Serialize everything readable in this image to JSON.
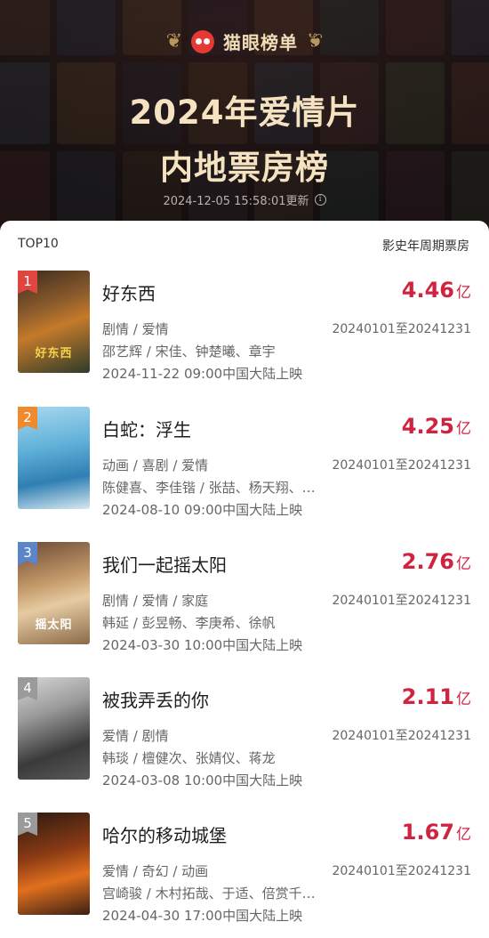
{
  "header": {
    "brand": "猫眼榜单",
    "title_line1": "2024年爱情片",
    "title_line2": "内地票房榜",
    "updated": "2024-12-05 15:58:01更新"
  },
  "list": {
    "top_label": "TOP10",
    "right_label": "影史年周期票房",
    "items": [
      {
        "rank": "1",
        "title": "好东西",
        "genre": "剧情 / 爱情",
        "cast": "邵艺辉 / 宋佳、钟楚曦、章宇",
        "release": "2024-11-22 09:00中国大陆上映",
        "period": "20240101至20241231",
        "box_value": "4.46",
        "box_unit": "亿",
        "poster_text": "好东西",
        "rank_color": "#e0463f"
      },
      {
        "rank": "2",
        "title": "白蛇：浮生",
        "genre": "动画 / 喜剧 / 爱情",
        "cast": "陈健喜、李佳锴 / 张喆、杨天翔、…",
        "release": "2024-08-10 09:00中国大陆上映",
        "period": "20240101至20241231",
        "box_value": "4.25",
        "box_unit": "亿",
        "poster_text": "",
        "rank_color": "#f08a2c"
      },
      {
        "rank": "3",
        "title": "我们一起摇太阳",
        "genre": "剧情 / 爱情 / 家庭",
        "cast": "韩延 / 彭昱畅、李庚希、徐帆",
        "release": "2024-03-30 10:00中国大陆上映",
        "period": "20240101至20241231",
        "box_value": "2.76",
        "box_unit": "亿",
        "poster_text": "摇太阳",
        "rank_color": "#5b84c9"
      },
      {
        "rank": "4",
        "title": "被我弄丢的你",
        "genre": "爱情 / 剧情",
        "cast": "韩琰 / 檀健次、张婧仪、蒋龙",
        "release": "2024-03-08 10:00中国大陆上映",
        "period": "20240101至20241231",
        "box_value": "2.11",
        "box_unit": "亿",
        "poster_text": "",
        "rank_color": "#9a9a9a"
      },
      {
        "rank": "5",
        "title": "哈尔的移动城堡",
        "genre": "爱情 / 奇幻 / 动画",
        "cast": "宫崎骏 / 木村拓哉、于适、倍赏千…",
        "release": "2024-04-30 17:00中国大陆上映",
        "period": "20240101至20241231",
        "box_value": "1.67",
        "box_unit": "亿",
        "poster_text": "",
        "rank_color": "#9a9a9a"
      }
    ]
  }
}
